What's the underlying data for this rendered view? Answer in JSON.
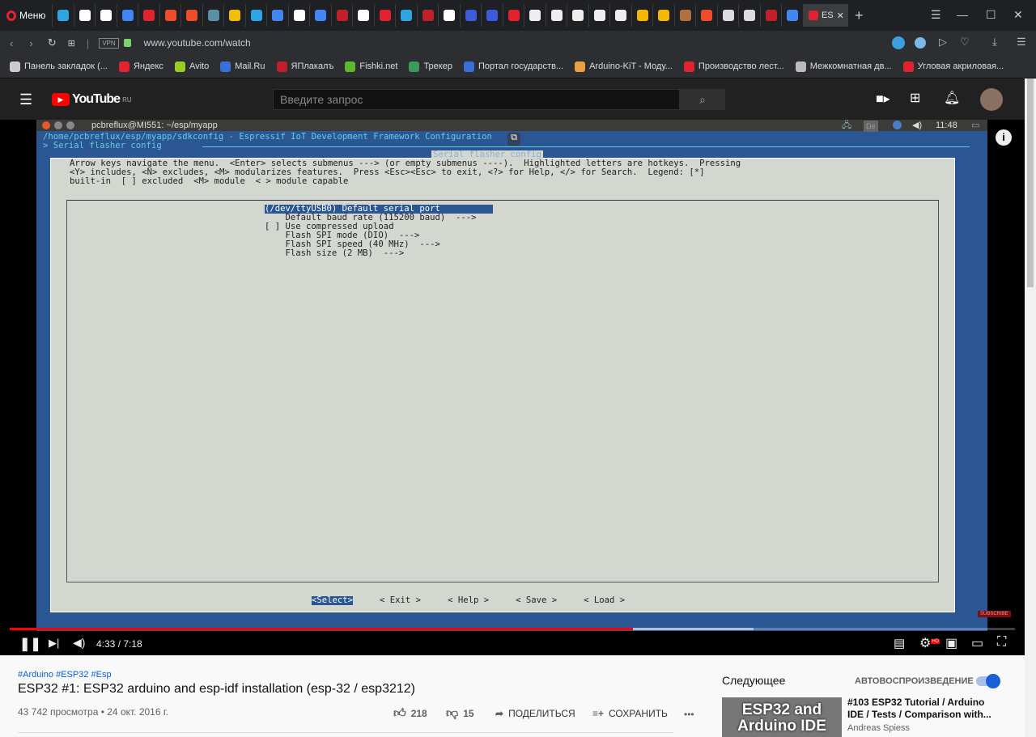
{
  "browser": {
    "menu_label": "Меню",
    "active_tab_label": "ES",
    "url": "www.youtube.com/watch",
    "vpn_label": "VPN",
    "tab_colors": [
      "#2ca5e0",
      "#fff",
      "#fff",
      "#4285f4",
      "#e0232e",
      "#ee4d2d",
      "#ee4d2d",
      "#5b8fa8",
      "#f0c000",
      "#2ca5e0",
      "#4285f4",
      "#fff",
      "#4285f4",
      "#c0202a",
      "#fff",
      "#e0232e",
      "#2ca5e0",
      "#c0202a",
      "#fff",
      "#3b5bdb",
      "#3b5bdb",
      "#e0232e",
      "#eee",
      "#eee",
      "#eee",
      "#eee",
      "#eee",
      "#f5b800",
      "#f5b800",
      "#b07040",
      "#ee4d2d",
      "#ddd",
      "#ddd",
      "#c0202a",
      "#4285f4"
    ],
    "bookmarks": [
      {
        "label": "Панель закладок (...",
        "color": "#ccc"
      },
      {
        "label": "Яндекс",
        "color": "#e0232e"
      },
      {
        "label": "Avito",
        "color": "#97cf26"
      },
      {
        "label": "Mail.Ru",
        "color": "#3b6fd8"
      },
      {
        "label": "ЯПлакалъ",
        "color": "#c0202a"
      },
      {
        "label": "Fishki.net",
        "color": "#5cb82c"
      },
      {
        "label": "Трекер",
        "color": "#3a9a5a"
      },
      {
        "label": "Портал государств...",
        "color": "#3b6fd8"
      },
      {
        "label": "Arduino-KiT - Моду...",
        "color": "#e8a040"
      },
      {
        "label": "Производство лест...",
        "color": "#e0232e"
      },
      {
        "label": "Межкомнатная дв...",
        "color": "#bbb"
      },
      {
        "label": "Угловая акриловая...",
        "color": "#e0232e"
      }
    ],
    "more": "»"
  },
  "youtube": {
    "logo": "YouTube",
    "region": "RU",
    "search_placeholder": "Введите запрос"
  },
  "terminal": {
    "window_title": "pcbreflux@MI551: ~/esp/myapp",
    "clock": "11:48",
    "kb": "De",
    "header": "/home/pcbreflux/esp/myapp/sdkconfig - Espressif IoT Development Framework Configuration",
    "breadcrumb": "> Serial flasher config",
    "dialog_title": "Serial flasher config",
    "help": [
      "Arrow keys navigate the menu.  <Enter> selects submenus ---> (or empty submenus ----).  Highlighted letters are hotkeys.  Pressing",
      "<Y> includes, <N> excludes, <M> modularizes features.  Press <Esc><Esc> to exit, <?> for Help, </> for Search.  Legend: [*]",
      "built-in  [ ] excluded  <M> module  < > module capable"
    ],
    "items": [
      "(/dev/ttyUSB0) Default serial port",
      "    Default baud rate (115200 baud)  --->",
      "[ ] Use compressed upload",
      "    Flash SPI mode (DIO)  --->",
      "    Flash SPI speed (40 MHz)  --->",
      "    Flash size (2 MB)  --->"
    ],
    "buttons": [
      "<Select>",
      "< Exit >",
      "< Help >",
      "< Save >",
      "< Load >"
    ]
  },
  "player": {
    "time": "4:33 / 7:18",
    "progress": 0.62,
    "buffered": 0.74,
    "subscribe": "SUBSCRIBE",
    "hd": "HD"
  },
  "video": {
    "tags": "#Arduino #ESP32 #Esp",
    "title": "ESP32 #1: ESP32 arduino and esp-idf installation (esp-32 / esp3212)",
    "meta": "43 742 просмотра • 24 окт. 2016 г.",
    "likes": "218",
    "dislikes": "15",
    "share": "ПОДЕЛИТЬСЯ",
    "save": "СОХРАНИТЬ",
    "more": "•••"
  },
  "sidebar": {
    "next": "Следующее",
    "autoplay": "АВТОВОСПРОИЗВЕДЕНИЕ",
    "autoplay_on": true,
    "thumb_text": "ESP32 and Arduino IDE",
    "rec_title": "#103 ESP32 Tutorial / Arduino IDE / Tests / Comparison with...",
    "rec_channel": "Andreas Spiess"
  }
}
